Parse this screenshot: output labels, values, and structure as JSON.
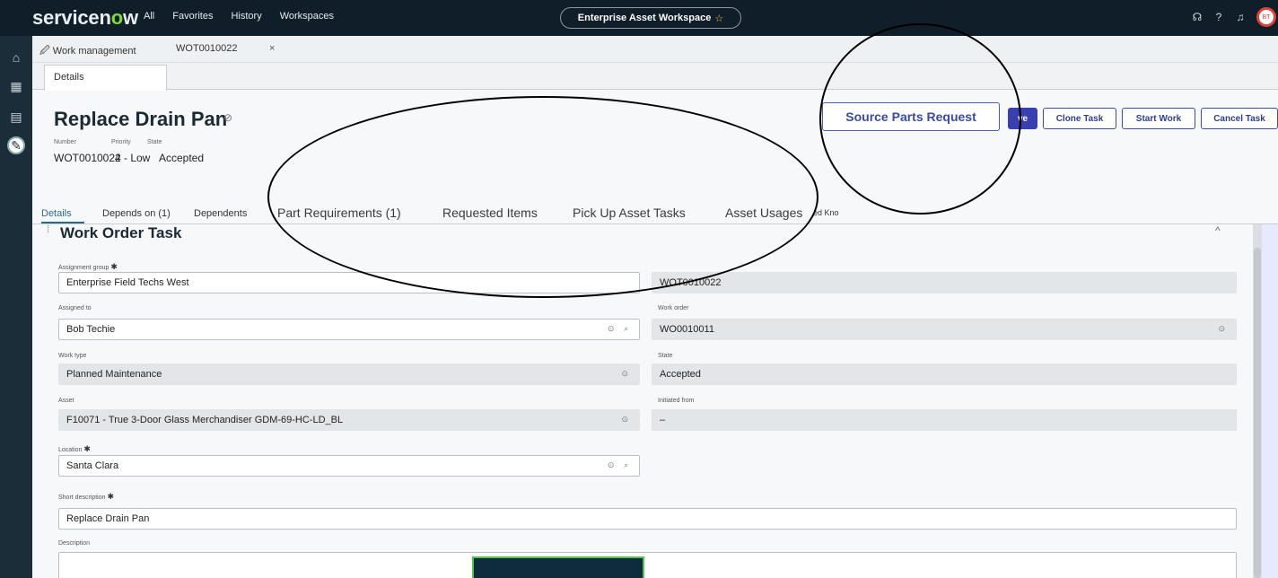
{
  "app": {
    "logo": "servicenow",
    "nav": [
      "All",
      "Favorites",
      "History",
      "Workspaces"
    ],
    "workspace": "Enterprise Asset Workspace",
    "avatar": "BT"
  },
  "tabs": {
    "module": "Work management",
    "record": "WOT0010022",
    "close": "×",
    "subtab": "Details"
  },
  "record": {
    "title": "Replace Drain Pan",
    "number_label": "Number",
    "number": "WOT0010022",
    "priority_label": "Priority",
    "priority": "4 - Low",
    "state_label": "State",
    "state": "Accepted"
  },
  "actions": {
    "source_parts": "Source Parts Request",
    "save": "ve",
    "clone": "Clone Task",
    "start": "Start Work",
    "cancel": "Cancel Task"
  },
  "record_tabs": {
    "details": "Details",
    "depends_on": "Depends on (1)",
    "dependents": "Dependents",
    "part_requirements": "Part Requirements (1)",
    "requested_items": "Requested Items",
    "pick_up": "Pick Up Asset Tasks",
    "asset_usages": "Asset Usages",
    "knowledge": "ed Kno"
  },
  "form": {
    "section_title": "Work Order Task",
    "assignment_group_label": "Assignment group",
    "assignment_group": "Enterprise Field Techs West",
    "number_value": "WOT0010022",
    "assigned_to_label": "Assigned to",
    "assigned_to": "Bob Techie",
    "work_order_label": "Work order",
    "work_order": "WO0010011",
    "work_type_label": "Work type",
    "work_type": "Planned Maintenance",
    "state_label": "State",
    "state": "Accepted",
    "asset_label": "Asset",
    "asset": "F10071 - True 3-Door Glass Merchandiser GDM-69-HC-LD_BL",
    "initiated_from_label": "Initiated from",
    "initiated_from": "–",
    "location_label": "Location",
    "location": "Santa Clara",
    "short_description_label": "Short description",
    "short_description": "Replace Drain Pan",
    "description_label": "Description",
    "description": ""
  }
}
